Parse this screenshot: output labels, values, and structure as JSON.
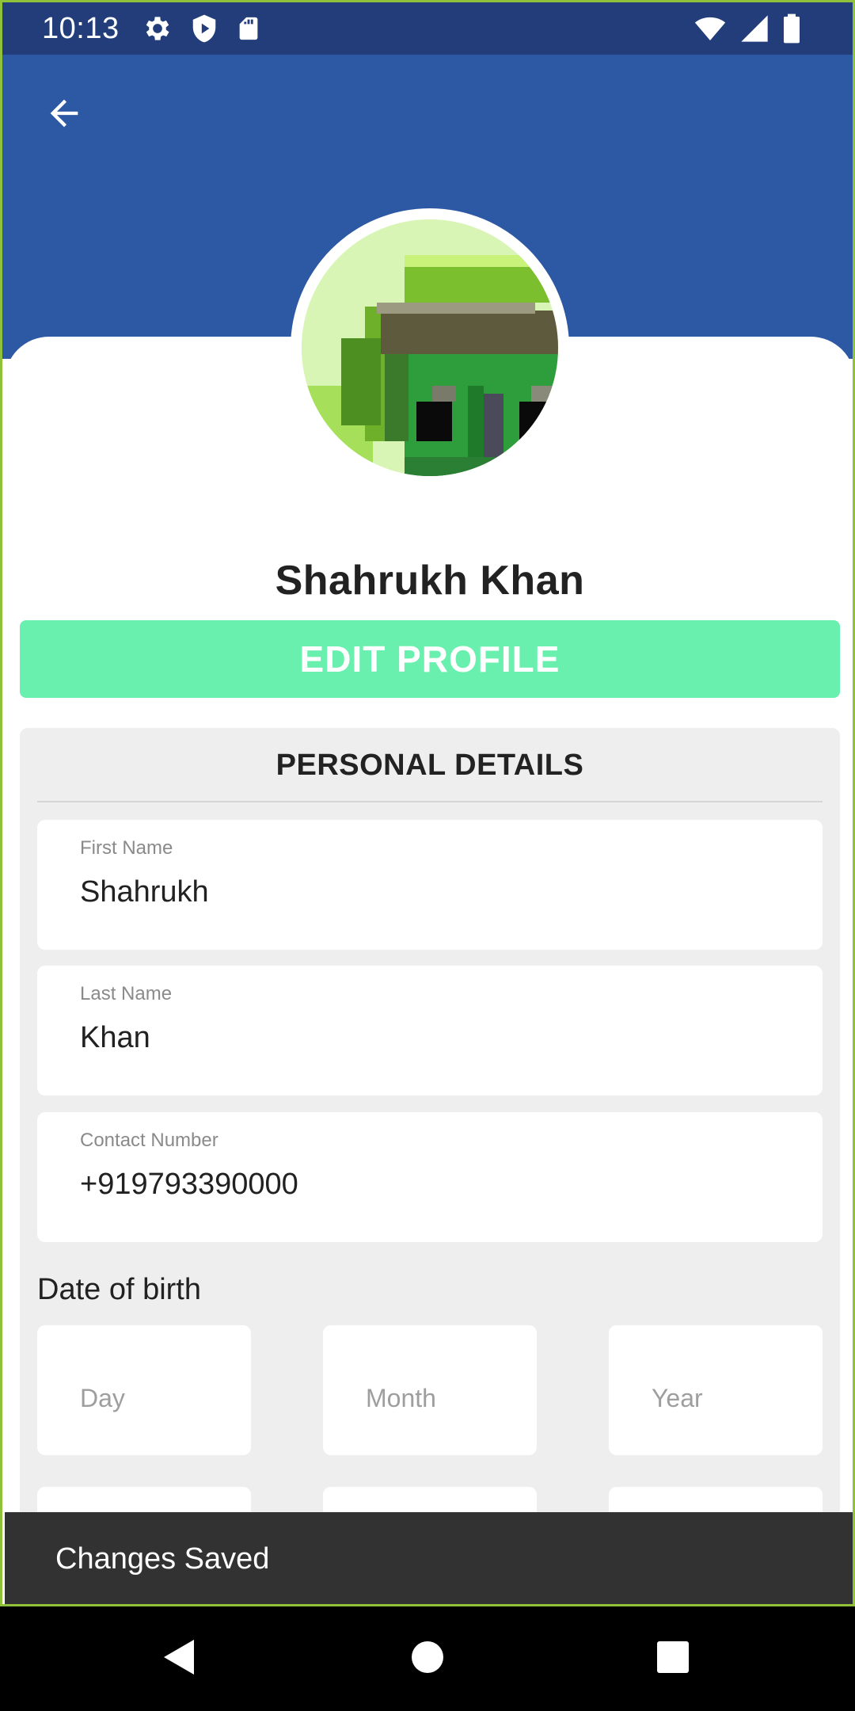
{
  "status_bar": {
    "time": "10:13",
    "left_icons": [
      "gear-icon",
      "shield-play-icon",
      "sd-card-icon"
    ],
    "right_icons": [
      "wifi-icon",
      "cell-signal-icon",
      "battery-icon"
    ]
  },
  "header": {
    "back_icon": "arrow-left-icon",
    "color": "#2d58a3"
  },
  "profile": {
    "name": "Shahrukh Khan",
    "edit_label": "EDIT PROFILE",
    "edit_color": "#69f0ae"
  },
  "details": {
    "title": "PERSONAL DETAILS",
    "fields": [
      {
        "label": "First Name",
        "value": "Shahrukh"
      },
      {
        "label": "Last Name",
        "value": "Khan"
      },
      {
        "label": "Contact Number",
        "value": "+919793390000"
      }
    ],
    "dob": {
      "label": "Date of birth",
      "day_placeholder": "Day",
      "month_placeholder": "Month",
      "year_placeholder": "Year"
    }
  },
  "snackbar": {
    "message": "Changes Saved"
  },
  "nav_bar": {
    "icons": [
      "back-triangle-icon",
      "home-circle-icon",
      "recents-square-icon"
    ]
  }
}
